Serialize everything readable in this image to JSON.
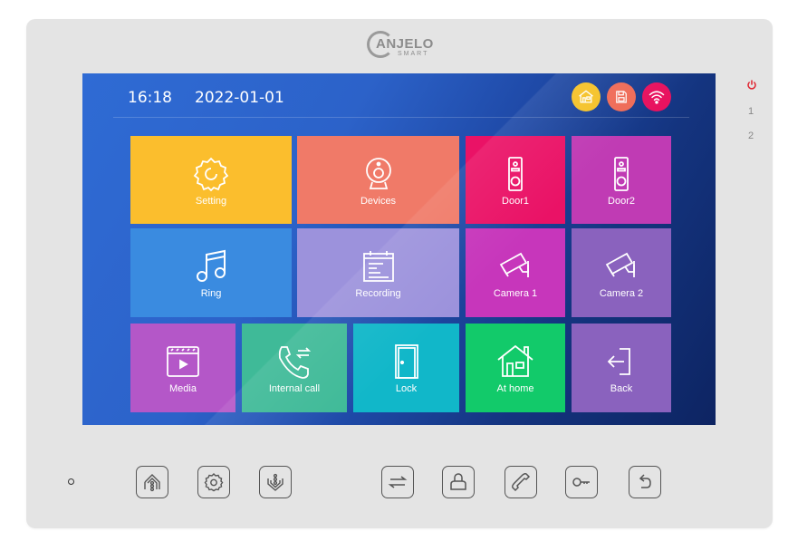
{
  "brand": {
    "name": "ANJELO",
    "tagline": "SMART"
  },
  "status_bar": {
    "time": "16:18",
    "date": "2022-01-01",
    "icons": [
      {
        "name": "home-status-icon",
        "color": "#f5c228"
      },
      {
        "name": "save-status-icon",
        "color": "#ef6b57"
      },
      {
        "name": "wifi-status-icon",
        "color": "#e8125f"
      }
    ]
  },
  "tiles": [
    {
      "label": "Setting",
      "icon": "gear-icon",
      "color": "#fbbe2d"
    },
    {
      "label": "Devices",
      "icon": "webcam-icon",
      "color": "#f07a68"
    },
    {
      "label": "Door1",
      "icon": "doorbell-icon",
      "color": "#ea1266"
    },
    {
      "label": "Door2",
      "icon": "doorbell-icon",
      "color": "#c03bb4"
    },
    {
      "label": "Ring",
      "icon": "music-note-icon",
      "color": "#3a8be0"
    },
    {
      "label": "Recording",
      "icon": "notepad-icon",
      "color": "#9c92dc"
    },
    {
      "label": "Camera 1",
      "icon": "cctv-camera-icon",
      "color": "#c736bb"
    },
    {
      "label": "Camera 2",
      "icon": "cctv-camera-icon",
      "color": "#8a62be"
    },
    {
      "label": "Media",
      "icon": "video-player-icon",
      "color": "#b457c8"
    },
    {
      "label": "Internal call",
      "icon": "phone-transfer-icon",
      "color": "#3fba98"
    },
    {
      "label": "Lock",
      "icon": "door-icon",
      "color": "#11b7c9"
    },
    {
      "label": "At home",
      "icon": "house-icon",
      "color": "#12ca6a"
    },
    {
      "label": "Back",
      "icon": "exit-icon",
      "color": "#8a62be"
    }
  ],
  "side_indicators": {
    "power_color": "#e0222e",
    "channels": [
      "1",
      "2"
    ]
  },
  "hardware_buttons": [
    {
      "name": "home-monitor-button",
      "icon": "home-signal-icon"
    },
    {
      "name": "settings-button",
      "icon": "gear-icon"
    },
    {
      "name": "monitor-button",
      "icon": "monitor-signal-icon"
    },
    {
      "name": "transfer-button",
      "icon": "swap-arrows-icon"
    },
    {
      "name": "user-button",
      "icon": "person-icon"
    },
    {
      "name": "call-button",
      "icon": "handset-icon"
    },
    {
      "name": "unlock-button",
      "icon": "key-icon"
    },
    {
      "name": "back-button",
      "icon": "return-arrow-icon"
    }
  ]
}
